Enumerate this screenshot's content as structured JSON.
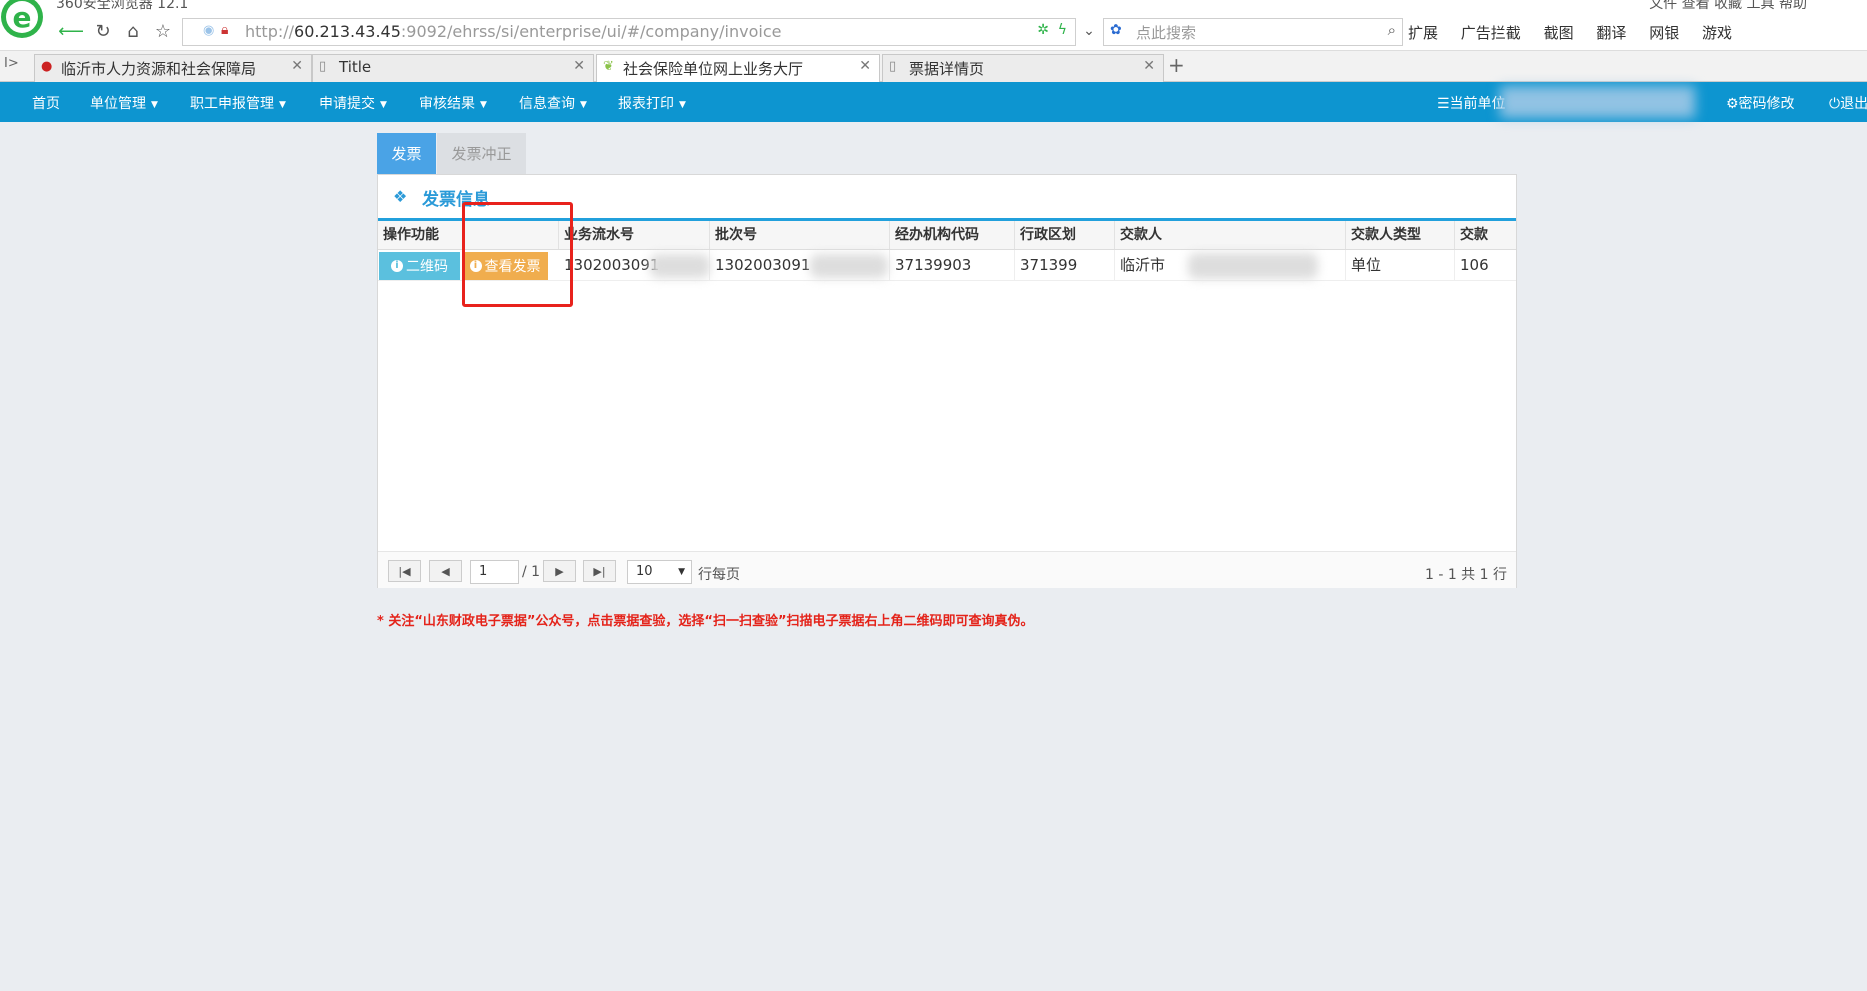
{
  "browser": {
    "title": "360安全浏览器 12.1",
    "menu": "文件  查看  收藏  工具  帮助",
    "url_prefix": "http://",
    "url_host": "60.213.43.45",
    "url_path": ":9092/ehrss/si/enterprise/ui/#/company/invoice",
    "search_placeholder": "点此搜索",
    "extensions": [
      "扩展",
      "广告拦截",
      "截图",
      "翻译",
      "网银",
      "游戏"
    ],
    "tabs": [
      {
        "label": "临沂市人力资源和社会保障局"
      },
      {
        "label": "Title"
      },
      {
        "label": "社会保险单位网上业务大厅"
      },
      {
        "label": "票据详情页"
      }
    ],
    "new_tab": "+"
  },
  "nav": {
    "items": [
      "首页",
      "单位管理",
      "职工申报管理",
      "申请提交",
      "审核结果",
      "信息查询",
      "报表打印"
    ],
    "current_unit_label": "☰当前单位",
    "password_change": "⚙密码修改",
    "logout": "⏻退出"
  },
  "page_tabs": {
    "invoice": "发票",
    "invoice_reversal": "发票冲正"
  },
  "panel": {
    "title": "发票信息",
    "columns": [
      "操作功能",
      "业务流水号",
      "批次号",
      "经办机构代码",
      "行政区划",
      "交款人",
      "交款人类型",
      "交款"
    ],
    "row": {
      "qr_button": "二维码",
      "view_invoice_button": "查看发票",
      "serial_no": "1302003091",
      "batch_no": "1302003091",
      "agency_code": "37139903",
      "region_code": "371399",
      "payer": "临沂市",
      "payer_type": "单位",
      "amount": "106"
    }
  },
  "pager": {
    "current_page": "1",
    "total_pages": "/ 1",
    "page_size": "10",
    "per_page_label": "行每页",
    "summary": "1 - 1 共 1 行"
  },
  "notice": "* 关注“山东财政电子票据”公众号，点击票据查验，选择“扫一扫查验”扫描电子票据右上角二维码即可查询真伪。",
  "colors": {
    "nav": "#0d95d0",
    "accent": "#21a0dc",
    "qr_button": "#5bc0de",
    "invoice_button": "#f0ad4e",
    "highlight": "#e8221c"
  }
}
